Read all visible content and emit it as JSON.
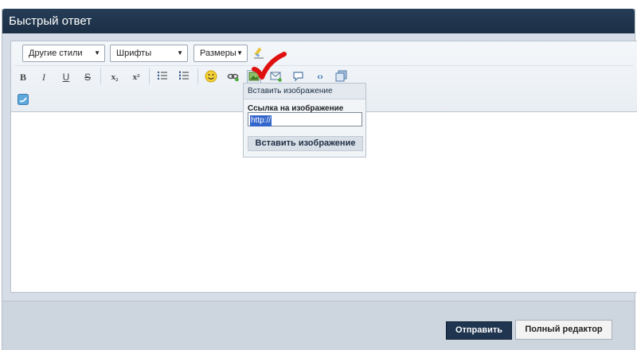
{
  "title": "Быстрый ответ",
  "toolbar": {
    "style_select": "Другие стили",
    "font_select": "Шрифты",
    "size_select": "Размеры",
    "bold": "B",
    "italic": "I",
    "underline": "U",
    "strike": "S",
    "subscript": "x₂",
    "superscript": "x²"
  },
  "popup": {
    "title": "Вставить изображение",
    "label": "Ссылка на изображение",
    "value": "http://",
    "button": "Вставить изображение"
  },
  "footer": {
    "submit": "Отправить",
    "full_editor": "Полный редактор"
  },
  "colors": {
    "accent": "#1f3550",
    "annotation_check": "#e01010"
  }
}
